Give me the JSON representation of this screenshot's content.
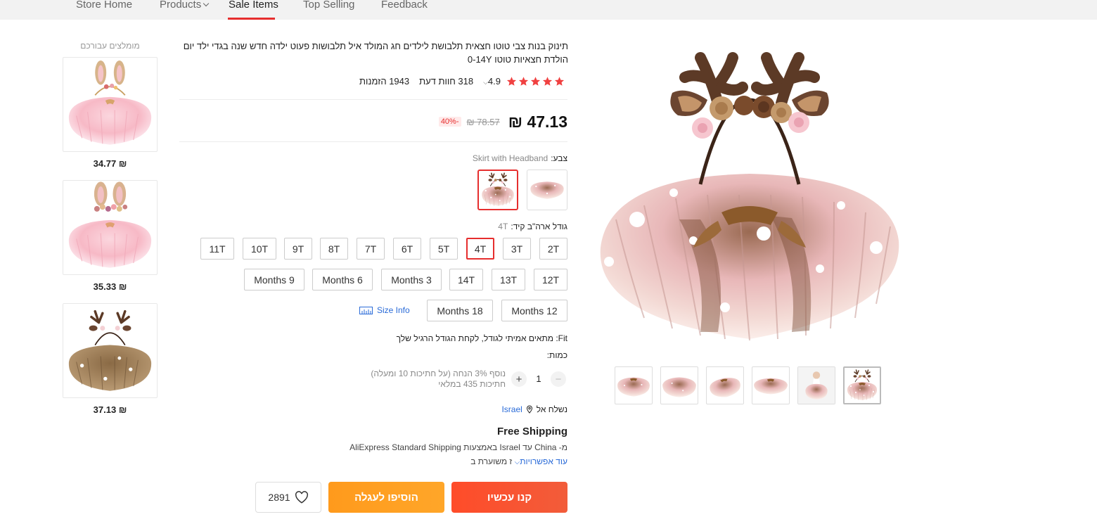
{
  "nav": {
    "items": [
      {
        "label": "Store Home"
      },
      {
        "label": "Products"
      },
      {
        "label": "Sale Items"
      },
      {
        "label": "Top Selling"
      },
      {
        "label": "Feedback"
      }
    ],
    "active": "Sale Items"
  },
  "recommended": {
    "title": "מומלצים עבורכם",
    "items": [
      {
        "price": "34.77 ₪",
        "icon": "bunny-tutu-pink"
      },
      {
        "price": "35.33 ₪",
        "icon": "bunny-tutu-flowers"
      },
      {
        "price": "37.13 ₪",
        "icon": "deer-tutu-brown"
      }
    ]
  },
  "product": {
    "title": "תינוק בנות צבי טוטו חצאית תלבושת לילדים חג המולד איל תלבושות פעוט ילדה חדש שנה בגדי ילד יום הולדת חצאיות טוטו 0-14Y",
    "rating": "4.9",
    "reviews": "318 חוות דעת",
    "orders": "1943 הזמנות",
    "price": "47.13 ₪",
    "original_price": "78.57 ₪",
    "discount": "-40%"
  },
  "color": {
    "label": "צבע:",
    "value": "Skirt with Headband",
    "swatches": [
      {
        "name": "skirt-with-headband",
        "selected": true
      },
      {
        "name": "skirt-only",
        "selected": false
      }
    ]
  },
  "size": {
    "label": "גודל ארה\"ב קיד:",
    "value": "4T",
    "options": [
      "2T",
      "3T",
      "4T",
      "5T",
      "6T",
      "7T",
      "8T",
      "9T",
      "10T",
      "11T",
      "12T",
      "13T",
      "14T",
      "Months 3",
      "Months 6",
      "Months 9",
      "Months 12",
      "Months 18"
    ],
    "selected": "4T",
    "size_info": "Size Info"
  },
  "fit": "Fit: מתאים אמיתי לגודל, לקחת הגודל הרגיל שלך",
  "quantity": {
    "label": "כמות:",
    "value": "1",
    "minus": "−",
    "plus": "+",
    "discount_note": "נוסף 3% הנחה (על חתיכות 10 ומעלה)",
    "stock_note": "חתיכות 435 במלאי"
  },
  "shipping": {
    "ship_to_label": "נשלח אל",
    "country": "Israel",
    "free": "Free Shipping",
    "method": "מ- China עד Israel באמצעות AliExpress Standard Shipping",
    "more_options": "עוד אפשרויות",
    "eta": "ז משוערת ב"
  },
  "actions": {
    "buy_now": "קנו עכשיו",
    "add_to_cart": "הוסיפו לעגלה",
    "wishlist_count": "2891"
  },
  "gallery": {
    "thumbs": 6,
    "selected_thumb": 6
  },
  "colors": {
    "accent": "#e62e2e",
    "buy": "#f5533a",
    "cart": "#ffa020",
    "link": "#2a6bd8"
  }
}
